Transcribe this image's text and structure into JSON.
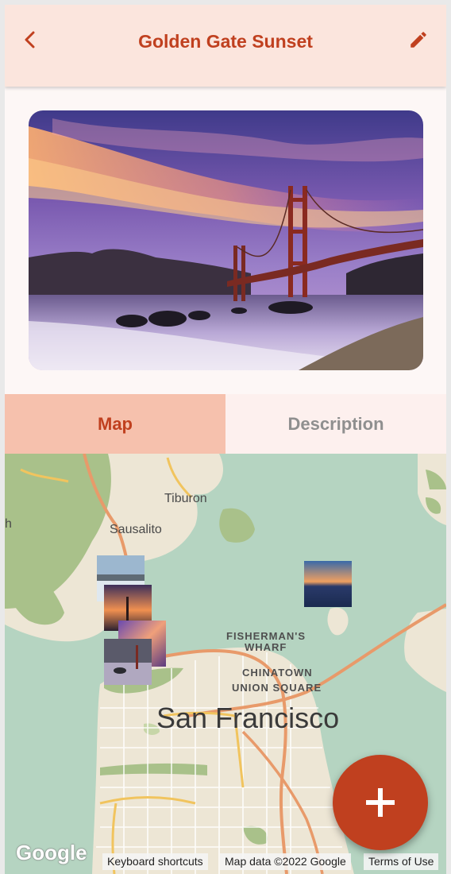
{
  "header": {
    "title": "Golden Gate Sunset",
    "back_icon": "chevron-left-icon",
    "edit_icon": "pencil-icon"
  },
  "photo": {
    "subject": "Golden Gate Bridge at sunset"
  },
  "tabs": [
    {
      "label": "Map",
      "active": true
    },
    {
      "label": "Description",
      "active": false
    }
  ],
  "map": {
    "labels": {
      "tiburon": "Tiburon",
      "sausalito": "Sausalito",
      "fishermans_wharf_1": "FISHERMAN'S",
      "fishermans_wharf_2": "WHARF",
      "chinatown": "CHINATOWN",
      "union_square": "UNION SQUARE",
      "san_francisco": "San Francisco",
      "edge_h": "h"
    },
    "google_logo": "Google",
    "keyboard_shortcuts": "Keyboard shortcuts",
    "map_data": "Map data ©2022 Google",
    "terms": "Terms of Use"
  },
  "fab": {
    "icon": "plus-icon"
  },
  "colors": {
    "accent": "#c0401f",
    "header_bg": "#fbe5dd",
    "tab_active_bg": "#f6c1ad",
    "tab_inactive_bg": "#fdf0ee",
    "water": "#b5d4c1",
    "land": "#ede6d5",
    "park": "#a9c18a"
  }
}
